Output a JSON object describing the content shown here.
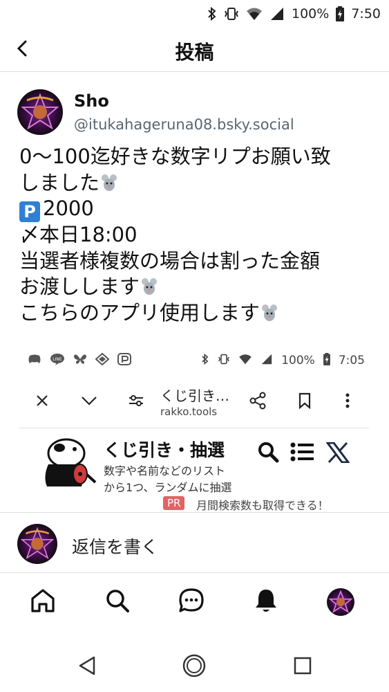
{
  "status_bar": {
    "battery": "100%",
    "time": "7:50",
    "icons": [
      "bluetooth-icon",
      "vibrate-icon",
      "wifi-icon",
      "signal-icon",
      "battery-charging-icon"
    ]
  },
  "header": {
    "back_icon": "chevron-left-icon",
    "title": "投稿"
  },
  "post": {
    "author_name": "Sho",
    "author_handle": "@itukahageruna08.bsky.social",
    "lines": [
      "0〜100迄好きな数字リプお願い致",
      "しました",
      "2000",
      "〆本日18:00",
      "当選者様複数の場合は割った金額",
      "お渡しします",
      "こちらのアプリ使用します"
    ],
    "parking_badge": "P",
    "embed": {
      "status": {
        "left_icons": [
          "discord-icon",
          "line-icon",
          "butterfly-icon",
          "diamond-icon",
          "paypay-icon"
        ],
        "battery": "100%",
        "time": "7:05"
      },
      "toolbar": {
        "close_icon": "close-icon",
        "expand_icon": "chevron-down-icon",
        "settings_icon": "tune-icon",
        "title": "くじ引き…",
        "url": "rakko.tools",
        "share_icon": "share-icon",
        "bookmark_icon": "bookmark-icon",
        "more_icon": "more-vertical-icon"
      },
      "site": {
        "title": "くじ引き・抽選",
        "subtitle_1": "数字や名前などのリスト",
        "subtitle_2": "から1つ、ランダムに抽選",
        "pr_badge": "PR",
        "pr_text": "月間検索数も取得できる！",
        "icons": [
          "search-icon",
          "menu-icon",
          "x-logo-icon"
        ]
      }
    }
  },
  "reply": {
    "placeholder": "返信を書く"
  },
  "bottom_nav": {
    "items": [
      "home-icon",
      "search-icon",
      "chat-icon",
      "bell-icon",
      "profile-avatar"
    ]
  },
  "system_nav": {
    "items": [
      "back-triangle-icon",
      "home-circle-icon",
      "recents-square-icon"
    ]
  },
  "colors": {
    "text": "#111111",
    "handle": "#5a6570",
    "divider": "#dde1e6",
    "parking_blue": "#2f7fd6",
    "pr_red": "#e06464"
  }
}
